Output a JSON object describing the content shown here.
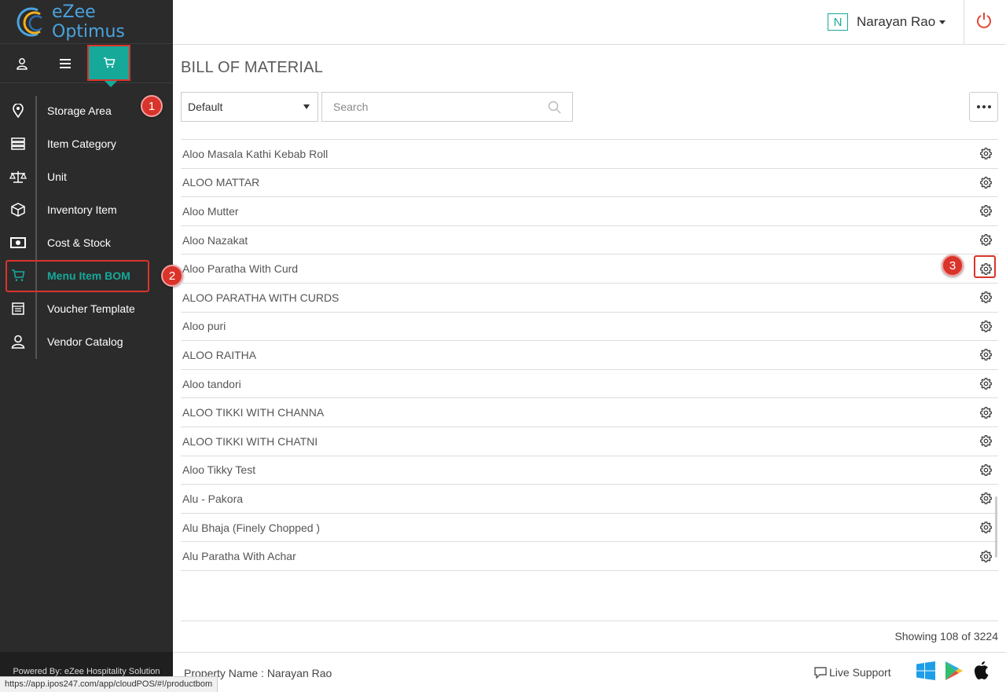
{
  "app": {
    "logo_text": "eZee Optimus"
  },
  "header": {
    "user_initial": "N",
    "user_name": "Narayan Rao"
  },
  "badges": {
    "b1": "1",
    "b2": "2",
    "b3": "3"
  },
  "sidebar": {
    "items": [
      {
        "label": "Storage Area",
        "icon": "location-pin-icon"
      },
      {
        "label": "Item Category",
        "icon": "list-icon"
      },
      {
        "label": "Unit",
        "icon": "scale-icon"
      },
      {
        "label": "Inventory Item",
        "icon": "box-icon"
      },
      {
        "label": "Cost & Stock",
        "icon": "money-icon"
      },
      {
        "label": "Menu Item BOM",
        "icon": "cart-icon",
        "active": true
      },
      {
        "label": "Voucher Template",
        "icon": "template-icon"
      },
      {
        "label": "Vendor Catalog",
        "icon": "user-icon"
      }
    ],
    "powered_by": "Powered By: eZee Hospitality Solution"
  },
  "main": {
    "title": "BILL OF MATERIAL",
    "filter_value": "Default",
    "search_placeholder": "Search",
    "rows": [
      "Aloo Masala Kathi Kebab Roll",
      "ALOO MATTAR",
      "Aloo Mutter",
      "Aloo Nazakat",
      "Aloo Paratha With Curd",
      "ALOO PARATHA WITH CURDS",
      "Aloo puri",
      "ALOO RAITHA",
      "Aloo tandori",
      "ALOO TIKKI WITH CHANNA",
      "ALOO TIKKI WITH CHATNI",
      "Aloo Tikky Test",
      "Alu - Pakora",
      "Alu Bhaja (Finely Chopped )",
      "Alu Paratha With Achar"
    ],
    "showing": "Showing 108 of 3224"
  },
  "footer": {
    "property": "Property Name : Narayan Rao",
    "live_support": "Live Support"
  },
  "status_url": "https://app.ipos247.com/app/cloudPOS/#!/productbom",
  "colors": {
    "accent": "#16a99a",
    "highlight": "#d9342b",
    "sidebar": "#2b2b2b"
  }
}
